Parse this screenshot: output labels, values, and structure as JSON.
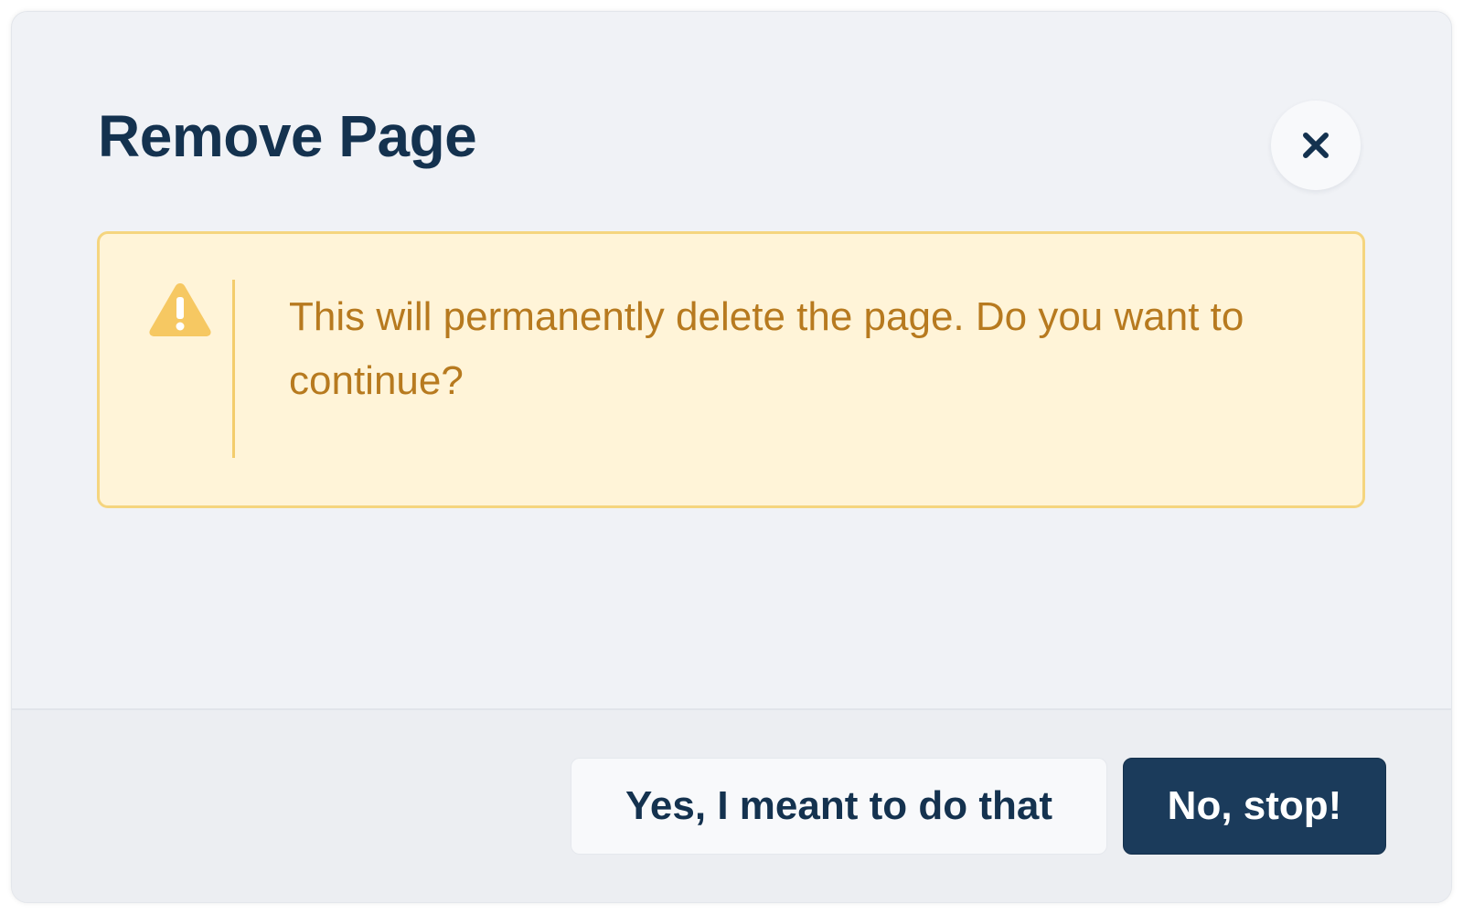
{
  "dialog": {
    "title": "Remove Page",
    "close_icon": "close-icon"
  },
  "alert": {
    "icon": "warning-icon",
    "message": "This will permanently delete the page. Do you want to continue?"
  },
  "footer": {
    "confirm_label": "Yes, I meant to do that",
    "cancel_label": "No, stop!"
  },
  "colors": {
    "title": "#14324f",
    "alert_background": "#fff4d8",
    "alert_border": "#f5d57f",
    "alert_text": "#b77a1f",
    "warning_icon": "#f6c862",
    "primary_button": "#1b3b5b"
  }
}
